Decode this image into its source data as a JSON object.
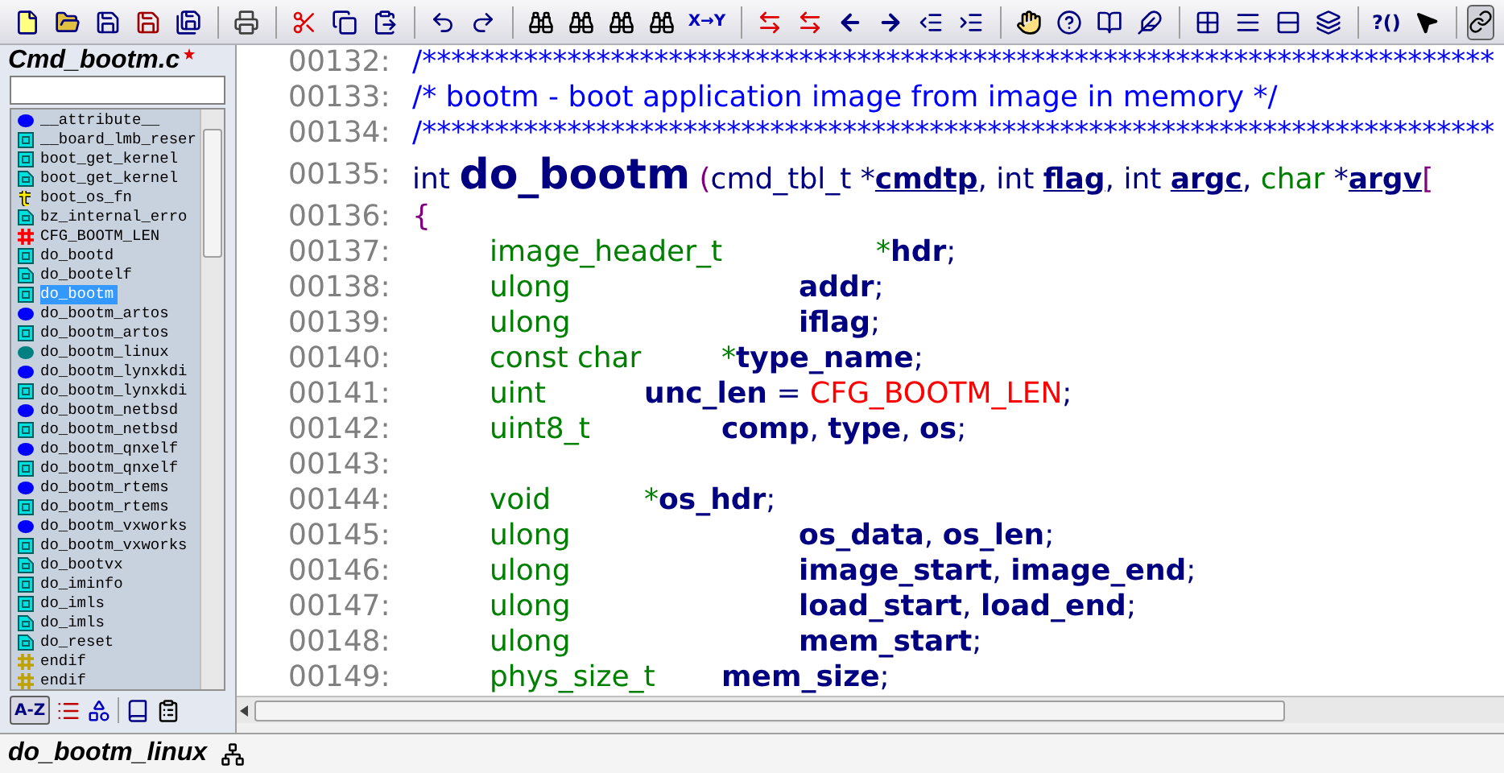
{
  "toolbar": {
    "labels": [
      "X→Y",
      "?()"
    ]
  },
  "symbol_panel": {
    "title": "Cmd_bootm.c",
    "modified": true,
    "symbols": [
      {
        "name": "__attribute__",
        "kind": "struct",
        "selected": false
      },
      {
        "name": "__board_lmb_reser",
        "kind": "function",
        "selected": false
      },
      {
        "name": "boot_get_kernel",
        "kind": "function",
        "selected": false
      },
      {
        "name": "boot_get_kernel",
        "kind": "prototype",
        "selected": false
      },
      {
        "name": "boot_os_fn",
        "kind": "typedef",
        "selected": false
      },
      {
        "name": "bz_internal_erro",
        "kind": "prototype",
        "selected": false
      },
      {
        "name": "CFG_BOOTM_LEN",
        "kind": "macro",
        "selected": false
      },
      {
        "name": "do_bootd",
        "kind": "function",
        "selected": false
      },
      {
        "name": "do_bootelf",
        "kind": "prototype",
        "selected": false
      },
      {
        "name": "do_bootm",
        "kind": "function",
        "selected": true
      },
      {
        "name": "do_bootm_artos",
        "kind": "struct",
        "selected": false
      },
      {
        "name": "do_bootm_artos",
        "kind": "function",
        "selected": false
      },
      {
        "name": "do_bootm_linux",
        "kind": "declaration",
        "selected": false
      },
      {
        "name": "do_bootm_lynxkdi",
        "kind": "struct",
        "selected": false
      },
      {
        "name": "do_bootm_lynxkdi",
        "kind": "function",
        "selected": false
      },
      {
        "name": "do_bootm_netbsd",
        "kind": "struct",
        "selected": false
      },
      {
        "name": "do_bootm_netbsd",
        "kind": "function",
        "selected": false
      },
      {
        "name": "do_bootm_qnxelf",
        "kind": "struct",
        "selected": false
      },
      {
        "name": "do_bootm_qnxelf",
        "kind": "function",
        "selected": false
      },
      {
        "name": "do_bootm_rtems",
        "kind": "struct",
        "selected": false
      },
      {
        "name": "do_bootm_rtems",
        "kind": "function",
        "selected": false
      },
      {
        "name": "do_bootm_vxworks",
        "kind": "struct",
        "selected": false
      },
      {
        "name": "do_bootm_vxworks",
        "kind": "function",
        "selected": false
      },
      {
        "name": "do_bootvx",
        "kind": "prototype",
        "selected": false
      },
      {
        "name": "do_iminfo",
        "kind": "function",
        "selected": false
      },
      {
        "name": "do_imls",
        "kind": "function",
        "selected": false
      },
      {
        "name": "do_imls",
        "kind": "prototype",
        "selected": false
      },
      {
        "name": "do_reset",
        "kind": "prototype",
        "selected": false
      },
      {
        "name": "endif",
        "kind": "conditional",
        "selected": false
      },
      {
        "name": "endif",
        "kind": "conditional",
        "selected": false
      }
    ],
    "tools": {
      "sort_label": "A-Z",
      "sort_selected": true
    }
  },
  "editor": {
    "lines": [
      {
        "number": "00132:",
        "tokens": [
          {
            "kind": "comment",
            "text": "/**************************************************************************"
          }
        ]
      },
      {
        "number": "00133:",
        "tokens": [
          {
            "kind": "comment",
            "text": "/* bootm - boot application image from image in memory */"
          }
        ]
      },
      {
        "number": "00134:",
        "tokens": [
          {
            "kind": "comment",
            "text": "/**************************************************************************"
          }
        ]
      },
      {
        "number": "00135:",
        "tokens": [
          {
            "kind": "plain",
            "text": "int "
          },
          {
            "kind": "func",
            "text": "do_bootm"
          },
          {
            "kind": "punct",
            "text": " ("
          },
          {
            "kind": "plain",
            "text": "cmd_tbl_t *"
          },
          {
            "kind": "param",
            "text": "cmdtp"
          },
          {
            "kind": "plain",
            "text": ", int "
          },
          {
            "kind": "param",
            "text": "flag"
          },
          {
            "kind": "plain",
            "text": ", int "
          },
          {
            "kind": "param",
            "text": "argc"
          },
          {
            "kind": "plain",
            "text": ", "
          },
          {
            "kind": "type",
            "text": "char"
          },
          {
            "kind": "plain",
            "text": " *"
          },
          {
            "kind": "param",
            "text": "argv"
          },
          {
            "kind": "punct",
            "text": "["
          }
        ]
      },
      {
        "number": "00136:",
        "tokens": [
          {
            "kind": "punct",
            "text": "{"
          }
        ]
      },
      {
        "number": "00137:",
        "tokens": [
          {
            "kind": "type",
            "text": "\timage_header_t\t\t*"
          },
          {
            "kind": "ident",
            "text": "hdr"
          },
          {
            "kind": "plain",
            "text": ";"
          }
        ]
      },
      {
        "number": "00138:",
        "tokens": [
          {
            "kind": "type",
            "text": "\tulong\t\t\t"
          },
          {
            "kind": "ident",
            "text": "addr"
          },
          {
            "kind": "plain",
            "text": ";"
          }
        ]
      },
      {
        "number": "00139:",
        "tokens": [
          {
            "kind": "type",
            "text": "\tulong\t\t\t"
          },
          {
            "kind": "ident",
            "text": "iflag"
          },
          {
            "kind": "plain",
            "text": ";"
          }
        ]
      },
      {
        "number": "00140:",
        "tokens": [
          {
            "kind": "type",
            "text": "\tconst char\t*"
          },
          {
            "kind": "ident",
            "text": "type_name"
          },
          {
            "kind": "plain",
            "text": ";"
          }
        ]
      },
      {
        "number": "00141:",
        "tokens": [
          {
            "kind": "type",
            "text": "\tuint\t\t"
          },
          {
            "kind": "ident",
            "text": "unc_len"
          },
          {
            "kind": "plain",
            "text": " = "
          },
          {
            "kind": "macro",
            "text": "CFG_BOOTM_LEN"
          },
          {
            "kind": "plain",
            "text": ";"
          }
        ]
      },
      {
        "number": "00142:",
        "tokens": [
          {
            "kind": "type",
            "text": "\tuint8_t\t\t"
          },
          {
            "kind": "ident",
            "text": "comp"
          },
          {
            "kind": "plain",
            "text": ", "
          },
          {
            "kind": "ident",
            "text": "type"
          },
          {
            "kind": "plain",
            "text": ", "
          },
          {
            "kind": "ident",
            "text": "os"
          },
          {
            "kind": "plain",
            "text": ";"
          }
        ]
      },
      {
        "number": "00143:"
      },
      {
        "number": "00144:",
        "tokens": [
          {
            "kind": "type",
            "text": "\tvoid\t\t*"
          },
          {
            "kind": "ident",
            "text": "os_hdr"
          },
          {
            "kind": "plain",
            "text": ";"
          }
        ]
      },
      {
        "number": "00145:",
        "tokens": [
          {
            "kind": "type",
            "text": "\tulong\t\t\t"
          },
          {
            "kind": "ident",
            "text": "os_data"
          },
          {
            "kind": "plain",
            "text": ", "
          },
          {
            "kind": "ident",
            "text": "os_len"
          },
          {
            "kind": "plain",
            "text": ";"
          }
        ]
      },
      {
        "number": "00146:",
        "tokens": [
          {
            "kind": "type",
            "text": "\tulong\t\t\t"
          },
          {
            "kind": "ident",
            "text": "image_start"
          },
          {
            "kind": "plain",
            "text": ", "
          },
          {
            "kind": "ident",
            "text": "image_end"
          },
          {
            "kind": "plain",
            "text": ";"
          }
        ]
      },
      {
        "number": "00147:",
        "tokens": [
          {
            "kind": "type",
            "text": "\tulong\t\t\t"
          },
          {
            "kind": "ident",
            "text": "load_start"
          },
          {
            "kind": "plain",
            "text": ", "
          },
          {
            "kind": "ident",
            "text": "load_end"
          },
          {
            "kind": "plain",
            "text": ";"
          }
        ]
      },
      {
        "number": "00148:",
        "tokens": [
          {
            "kind": "type",
            "text": "\tulong\t\t\t"
          },
          {
            "kind": "ident",
            "text": "mem_start"
          },
          {
            "kind": "plain",
            "text": ";"
          }
        ]
      },
      {
        "number": "00149:",
        "tokens": [
          {
            "kind": "type",
            "text": "\tphys_size_t\t"
          },
          {
            "kind": "ident",
            "text": "mem_size"
          },
          {
            "kind": "plain",
            "text": ";"
          }
        ]
      }
    ]
  },
  "status_bar": {
    "symbol": "do_bootm_linux"
  }
}
